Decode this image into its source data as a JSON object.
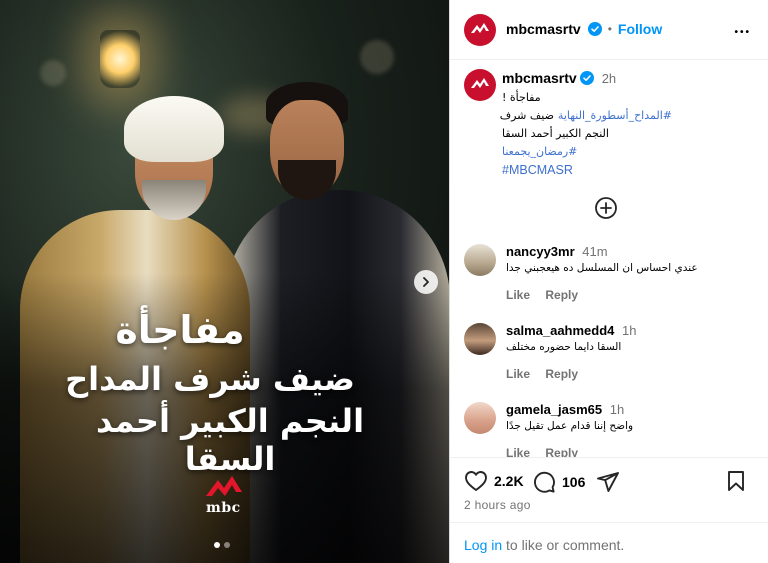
{
  "media": {
    "overlay_line1": "مفاجأة",
    "overlay_line2": "ضيف شرف المداح",
    "overlay_line3": "النجم الكبير أحمد السقا",
    "logo_text": "mbc",
    "carousel_count": 2,
    "carousel_active": 1
  },
  "header": {
    "username": "mbcmasrtv",
    "separator": "•",
    "follow_label": "Follow",
    "more_label": "•••"
  },
  "caption": {
    "username": "mbcmasrtv",
    "time": "2h",
    "line1": "مفاجأة !",
    "line2_prefix": "ضيف شرف ",
    "line2_tag": "#المداح_أسطورة_النهاية",
    "line3": "النجم الكبير أحمد السقا",
    "line4_tag": "#رمضان_يجمعنا",
    "line5_tag": "#MBCMASR"
  },
  "comments": [
    {
      "username": "nancyy3mr",
      "time": "41m",
      "text": "عندي احساس ان المسلسل ده هيعجبني جدا",
      "like": "Like",
      "reply": "Reply"
    },
    {
      "username": "salma_aahmedd4",
      "time": "1h",
      "text": "السقا دايما حضوره مختلف",
      "like": "Like",
      "reply": "Reply"
    },
    {
      "username": "gamela_jasm65",
      "time": "1h",
      "text": "واضح إننا قدام عمل تقيل جدًا",
      "like": "Like",
      "reply": "Reply"
    }
  ],
  "actions": {
    "likes": "2.2K",
    "comments": "106"
  },
  "timestamp": "2 hours ago",
  "login": {
    "link": "Log in",
    "rest": " to like or comment."
  },
  "colors": {
    "brand_red": "#c8102e",
    "link_blue": "#0095f6",
    "hashtag_blue": "#3d6fcf",
    "verified_blue": "#0095f6"
  }
}
